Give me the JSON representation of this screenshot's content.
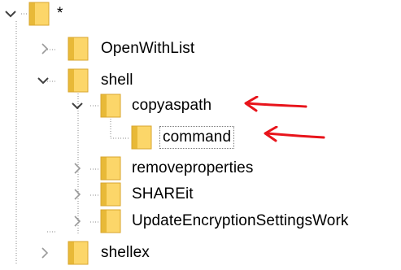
{
  "colors": {
    "folder": "#fcd669",
    "folder_tab": "#e8b938",
    "folder_edge": "#d9a62e",
    "guide": "#8a8a8a",
    "chevron": "#404040",
    "chevron_light": "#9a9a9a",
    "annotation": "#e8141b"
  },
  "tree": {
    "root": {
      "label": "*",
      "expanded": true,
      "icon": "folder-icon"
    },
    "items": [
      {
        "label": "OpenWithList",
        "expanded": false,
        "icon": "folder-icon"
      },
      {
        "label": "shell",
        "expanded": true,
        "icon": "folder-icon"
      },
      {
        "label": "copyaspath",
        "expanded": true,
        "icon": "folder-icon",
        "annotated": true
      },
      {
        "label": "command",
        "expanded": false,
        "icon": "folder-icon",
        "annotated": true,
        "selected": true
      },
      {
        "label": "removeproperties",
        "expanded": false,
        "icon": "folder-icon"
      },
      {
        "label": "SHAREit",
        "expanded": false,
        "icon": "folder-icon"
      },
      {
        "label": "UpdateEncryptionSettingsWork",
        "expanded": false,
        "icon": "folder-icon"
      },
      {
        "label": "shellex",
        "expanded": false,
        "icon": "folder-icon"
      }
    ]
  }
}
